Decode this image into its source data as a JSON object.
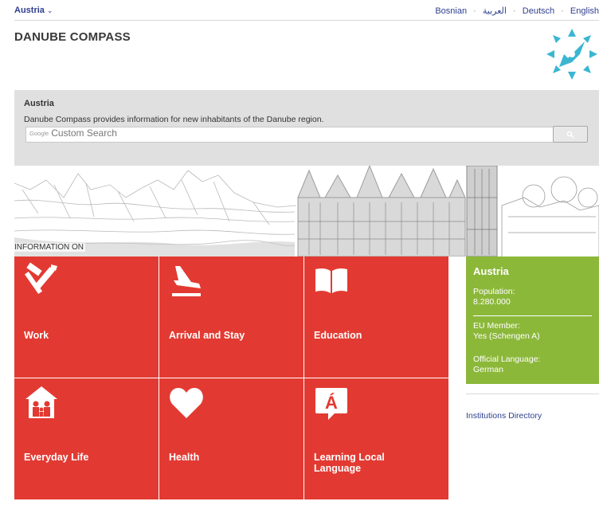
{
  "topbar": {
    "country": "Austria",
    "caret": "⌄",
    "languages": [
      "Bosnian",
      "العربية",
      "Deutsch",
      "English"
    ],
    "separator": "·"
  },
  "site": {
    "title": "DANUBE COMPASS",
    "logo_icon": "compass-icon",
    "logo_color": "#3bb6d1"
  },
  "search_panel": {
    "title": "Austria",
    "description": "Danube Compass provides information for new inhabitants of the Danube region.",
    "google_brand": "Google",
    "placeholder": "Custom Search",
    "button_icon": "search-icon"
  },
  "banner": {
    "label": "INFORMATION ON"
  },
  "tiles": [
    {
      "label": "Work",
      "icon": "tools-icon"
    },
    {
      "label": "Arrival and Stay",
      "icon": "plane-landing-icon"
    },
    {
      "label": "Education",
      "icon": "book-icon"
    },
    {
      "label": "Everyday Life",
      "icon": "family-house-icon"
    },
    {
      "label": "Health",
      "icon": "heart-icon"
    },
    {
      "label": "Learning Local Language",
      "icon": "speech-bubble-icon"
    }
  ],
  "country_info": {
    "title": "Austria",
    "population_label": "Population:",
    "population_value": "8.280.000",
    "eu_label": "EU Member:",
    "eu_value": "Yes (Schengen A)",
    "language_label": "Official Language:",
    "language_value": "German"
  },
  "links": {
    "institutions": "Institutions Directory"
  },
  "colors": {
    "tile_red": "#e23a32",
    "info_green": "#8cb83a",
    "link_blue": "#2f3f8f",
    "panel_gray": "#e0e0e0"
  }
}
